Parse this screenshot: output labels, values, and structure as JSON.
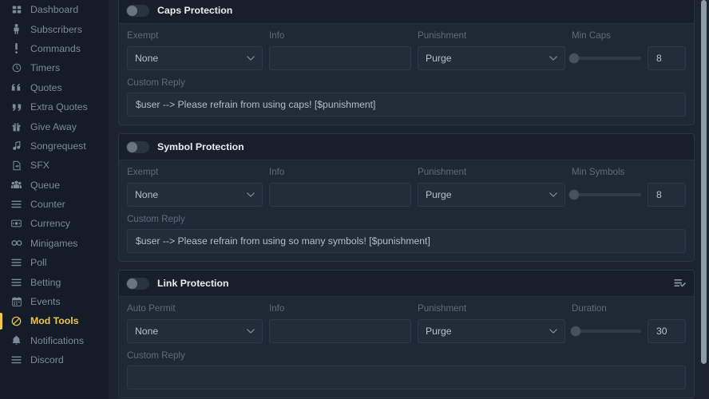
{
  "sidebar": {
    "items": [
      {
        "label": "Dashboard",
        "icon": "dashboard-icon",
        "active": false
      },
      {
        "label": "Subscribers",
        "icon": "user-icon",
        "active": false
      },
      {
        "label": "Commands",
        "icon": "exclamation-icon",
        "active": false
      },
      {
        "label": "Timers",
        "icon": "clock-icon",
        "active": false
      },
      {
        "label": "Quotes",
        "icon": "quote-close-icon",
        "active": false
      },
      {
        "label": "Extra Quotes",
        "icon": "quote-open-icon",
        "active": false
      },
      {
        "label": "Give Away",
        "icon": "gift-icon",
        "active": false
      },
      {
        "label": "Songrequest",
        "icon": "music-note-icon",
        "active": false
      },
      {
        "label": "SFX",
        "icon": "audio-file-icon",
        "active": false
      },
      {
        "label": "Queue",
        "icon": "users-group-icon",
        "active": false
      },
      {
        "label": "Counter",
        "icon": "list-icon",
        "active": false
      },
      {
        "label": "Currency",
        "icon": "banknote-icon",
        "active": false
      },
      {
        "label": "Minigames",
        "icon": "chain-link-icon",
        "active": false
      },
      {
        "label": "Poll",
        "icon": "list-icon",
        "active": false
      },
      {
        "label": "Betting",
        "icon": "list-icon",
        "active": false
      },
      {
        "label": "Events",
        "icon": "calendar-icon",
        "active": false
      },
      {
        "label": "Mod Tools",
        "icon": "ban-circle-icon",
        "active": true
      },
      {
        "label": "Notifications",
        "icon": "bell-icon",
        "active": false
      },
      {
        "label": "Discord",
        "icon": "list-icon",
        "active": false
      }
    ],
    "active_color": "#f0c548"
  },
  "panels": [
    {
      "title": "Caps Protection",
      "toggle_on": false,
      "has_head_icon": false,
      "first_label": "Exempt",
      "first_value": "None",
      "info_label": "Info",
      "info_value": "",
      "punishment_label": "Punishment",
      "punishment_value": "Purge",
      "slider_label": "Min Caps",
      "slider_value": "8",
      "slider_percent": 4,
      "reply_label": "Custom Reply",
      "reply_value": "$user --> Please refrain from using caps! [$punishment]"
    },
    {
      "title": "Symbol Protection",
      "toggle_on": false,
      "has_head_icon": false,
      "first_label": "Exempt",
      "first_value": "None",
      "info_label": "Info",
      "info_value": "",
      "punishment_label": "Punishment",
      "punishment_value": "Purge",
      "slider_label": "Min Symbols",
      "slider_value": "8",
      "slider_percent": 4,
      "reply_label": "Custom Reply",
      "reply_value": "$user --> Please refrain from using so many symbols! [$punishment]"
    },
    {
      "title": "Link Protection",
      "toggle_on": false,
      "has_head_icon": true,
      "head_icon": "list-check-icon",
      "first_label": "Auto Permit",
      "first_value": "None",
      "info_label": "Info",
      "info_value": "",
      "punishment_label": "Punishment",
      "punishment_value": "Purge",
      "slider_label": "Duration",
      "slider_value": "30",
      "slider_percent": 6,
      "reply_label": "Custom Reply",
      "reply_value": ""
    }
  ],
  "scrollbar": {
    "thumb_percent": 91
  }
}
